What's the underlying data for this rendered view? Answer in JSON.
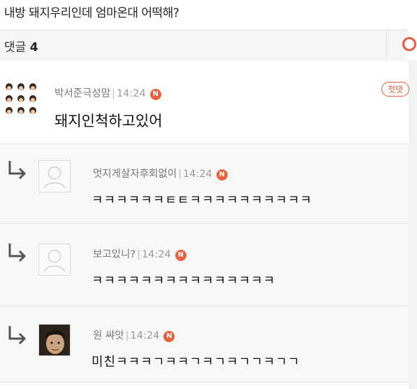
{
  "post": {
    "title": "내방 돼지우리인데 엄마온대 어떡해?"
  },
  "comment_header": {
    "label": "댓글",
    "count": "4"
  },
  "comments": [
    {
      "author": "박서준극성맘",
      "time": "14:24",
      "badge": "N",
      "tag": "첫댓",
      "text": "돼지인척하고있어"
    },
    {
      "author": "멋지게살자후회없이",
      "time": "14:24",
      "badge": "N",
      "text": "ㅋㅋㅋㅋㅋㅋㅌㅌㅋㅋㅋㅋㅋㅋㅋㅋㅋㅋ"
    },
    {
      "author": "보고있니?",
      "time": "14:24",
      "badge": "N",
      "text": "ㅋㅋㅋㅋㅋㅋㅋㅋㅋㅋㅋㅋㅋㅋㅋ"
    },
    {
      "author": "원 쌰앗",
      "time": "14:24",
      "badge": "N",
      "text": "미친ㅋㅋㅋㄱㅋㅋㄱㅋㄱㅋㄱㄱㅋㄱㄱ"
    }
  ],
  "colors": {
    "accent": "#e85c3c",
    "badge": "#e8613e",
    "reply_bg": "#f7f7f7"
  },
  "icons": {
    "reply": "reply-arrow-icon",
    "default_avatar": "default-avatar-icon",
    "refresh": "refresh-icon"
  }
}
